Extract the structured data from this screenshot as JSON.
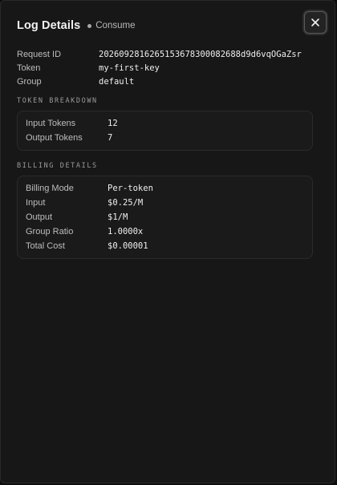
{
  "header": {
    "title": "Log Details",
    "status": "Consume",
    "close_icon": "close-icon"
  },
  "meta": [
    {
      "label": "Request ID",
      "value": "2026092816265153678300082688d9d6vqOGaZsr"
    },
    {
      "label": "Token",
      "value": "my-first-key"
    },
    {
      "label": "Group",
      "value": "default"
    }
  ],
  "token_breakdown": {
    "title": "TOKEN BREAKDOWN",
    "rows": [
      {
        "label": "Input Tokens",
        "value": "12"
      },
      {
        "label": "Output Tokens",
        "value": "7"
      }
    ]
  },
  "billing_details": {
    "title": "BILLING DETAILS",
    "rows": [
      {
        "label": "Billing Mode",
        "value": "Per-token"
      },
      {
        "label": "Input",
        "value": "$0.25/M"
      },
      {
        "label": "Output",
        "value": "$1/M"
      },
      {
        "label": "Group Ratio",
        "value": "1.0000x"
      },
      {
        "label": "Total Cost",
        "value": "$0.00001"
      }
    ]
  }
}
